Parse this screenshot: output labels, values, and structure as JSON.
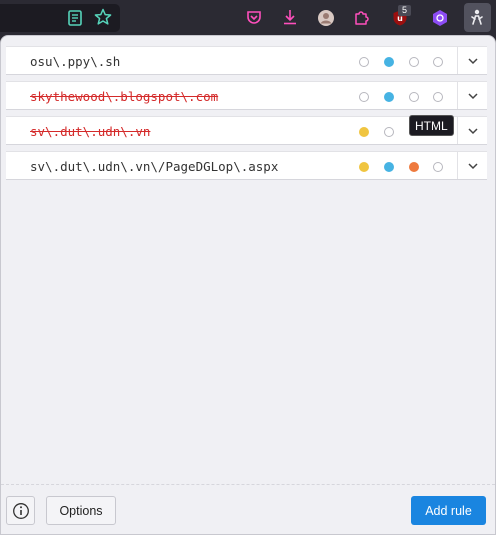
{
  "toolbar": {
    "extension_badge": "5"
  },
  "rules": [
    {
      "pattern": "osu\\.ppy\\.sh",
      "disabled": false,
      "dots": [
        "empty",
        "blue",
        "empty",
        "empty"
      ]
    },
    {
      "pattern": "skythewood\\.blogspot\\.com",
      "disabled": true,
      "dots": [
        "empty",
        "blue",
        "empty",
        "empty"
      ]
    },
    {
      "pattern": "sv\\.dut\\.udn\\.vn",
      "disabled": true,
      "dots": [
        "yellow",
        "empty",
        "hidden",
        "hidden"
      ]
    },
    {
      "pattern": "sv\\.dut\\.udn\\.vn\\/PageDGLop\\.aspx",
      "disabled": false,
      "dots": [
        "yellow",
        "blue",
        "orange",
        "empty"
      ]
    }
  ],
  "tooltip": "HTML",
  "footer": {
    "options_label": "Options",
    "add_rule_label": "Add rule"
  },
  "colors": {
    "yellow": "#f0c541",
    "blue": "#46b3e3",
    "orange": "#ee7a3e",
    "primary": "#1a85e0",
    "disabled_text": "#d42a2a"
  }
}
